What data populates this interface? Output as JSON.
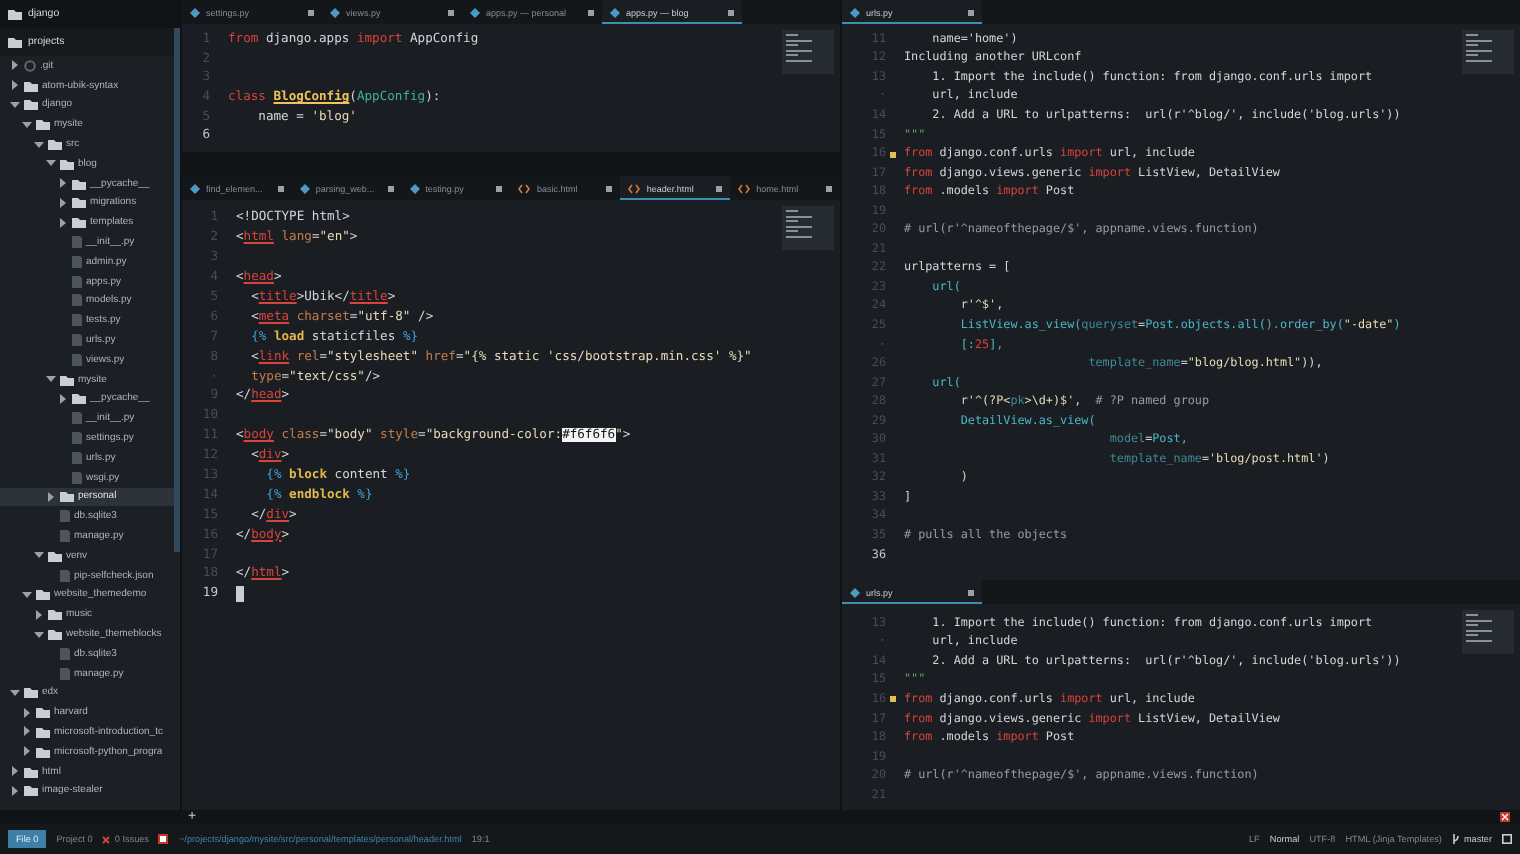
{
  "sidebar": {
    "roots": [
      {
        "name": "django"
      },
      {
        "name": "projects",
        "children": [
          {
            "name": ".git",
            "kind": "repo",
            "expanded": false,
            "selected": false
          },
          {
            "name": "atom-ubik-syntax",
            "kind": "folder",
            "expanded": false,
            "selected": false
          },
          {
            "name": "django",
            "kind": "folder",
            "expanded": true,
            "selected": false,
            "children": [
              {
                "name": "mysite",
                "kind": "folder",
                "expanded": true,
                "selected": false,
                "children": [
                  {
                    "name": "src",
                    "kind": "folder",
                    "expanded": true,
                    "selected": false,
                    "children": [
                      {
                        "name": "blog",
                        "kind": "folder",
                        "expanded": true,
                        "selected": false,
                        "children": [
                          {
                            "name": "__pycache__",
                            "kind": "folder",
                            "expanded": false,
                            "selected": false
                          },
                          {
                            "name": "migrations",
                            "kind": "folder",
                            "expanded": false,
                            "selected": false
                          },
                          {
                            "name": "templates",
                            "kind": "folder",
                            "expanded": false,
                            "selected": false
                          },
                          {
                            "name": "__init__.py",
                            "kind": "file",
                            "selected": false
                          },
                          {
                            "name": "admin.py",
                            "kind": "file",
                            "selected": false
                          },
                          {
                            "name": "apps.py",
                            "kind": "file",
                            "selected": false
                          },
                          {
                            "name": "models.py",
                            "kind": "file",
                            "selected": false
                          },
                          {
                            "name": "tests.py",
                            "kind": "file",
                            "selected": false
                          },
                          {
                            "name": "urls.py",
                            "kind": "file",
                            "selected": false
                          },
                          {
                            "name": "views.py",
                            "kind": "file",
                            "selected": false
                          }
                        ]
                      },
                      {
                        "name": "mysite",
                        "kind": "folder",
                        "expanded": true,
                        "selected": false,
                        "children": [
                          {
                            "name": "__pycache__",
                            "kind": "folder",
                            "expanded": false,
                            "selected": false
                          },
                          {
                            "name": "__init__.py",
                            "kind": "file",
                            "selected": false
                          },
                          {
                            "name": "settings.py",
                            "kind": "file",
                            "selected": false
                          },
                          {
                            "name": "urls.py",
                            "kind": "file",
                            "selected": false
                          },
                          {
                            "name": "wsgi.py",
                            "kind": "file",
                            "selected": false
                          }
                        ]
                      },
                      {
                        "name": "personal",
                        "kind": "folder",
                        "expanded": false,
                        "selected": true
                      },
                      {
                        "name": "db.sqlite3",
                        "kind": "file",
                        "selected": false
                      },
                      {
                        "name": "manage.py",
                        "kind": "file",
                        "selected": false
                      }
                    ]
                  },
                  {
                    "name": "venv",
                    "kind": "folder",
                    "expanded": true,
                    "selected": false,
                    "children": [
                      {
                        "name": "pip-selfcheck.json",
                        "kind": "file",
                        "selected": false
                      }
                    ]
                  }
                ]
              },
              {
                "name": "website_themedemo",
                "kind": "folder",
                "expanded": true,
                "selected": false,
                "children": [
                  {
                    "name": "music",
                    "kind": "folder",
                    "expanded": false,
                    "selected": false
                  },
                  {
                    "name": "website_themeblocks",
                    "kind": "folder",
                    "expanded": true,
                    "selected": false,
                    "children": [
                      {
                        "name": "db.sqlite3",
                        "kind": "file",
                        "selected": false
                      },
                      {
                        "name": "manage.py",
                        "kind": "file",
                        "selected": false
                      }
                    ]
                  }
                ]
              }
            ]
          },
          {
            "name": "edx",
            "kind": "folder",
            "expanded": true,
            "selected": false,
            "children": [
              {
                "name": "harvard",
                "kind": "folder",
                "expanded": false,
                "selected": false
              },
              {
                "name": "microsoft-introduction_tc",
                "kind": "folder",
                "expanded": false,
                "selected": false
              },
              {
                "name": "microsoft-python_progra",
                "kind": "folder",
                "expanded": false,
                "selected": false
              }
            ]
          },
          {
            "name": "html",
            "kind": "folder",
            "expanded": false,
            "selected": false
          },
          {
            "name": "image-stealer",
            "kind": "folder",
            "expanded": false,
            "selected": false
          }
        ]
      }
    ]
  },
  "panes": [
    {
      "focused": false,
      "tabs": [
        {
          "label": "settings.py",
          "kind": "python",
          "selected": false
        },
        {
          "label": "views.py",
          "kind": "python",
          "selected": false
        },
        {
          "label": "apps.py — personal",
          "kind": "python",
          "selected": false
        },
        {
          "label": "apps.py — blog",
          "kind": "python",
          "selected": true
        }
      ],
      "lines": [
        {
          "number": "1",
          "current": false,
          "changed": false,
          "tokens": [
            {
              "text": "from",
              "kind": "kw"
            },
            {
              "text": " django.apps ",
              "kind": "plain"
            },
            {
              "text": "import",
              "kind": "kw"
            },
            {
              "text": " AppConfig",
              "kind": "plain"
            }
          ]
        },
        {
          "number": "2",
          "current": false,
          "changed": false
        },
        {
          "number": "3",
          "current": false,
          "changed": false
        },
        {
          "number": "4",
          "current": false,
          "changed": false,
          "tokens": [
            {
              "text": "class ",
              "kind": "kw"
            },
            {
              "text": "BlogConfig",
              "kind": "cls"
            },
            {
              "text": "(",
              "kind": "plain"
            },
            {
              "text": "AppConfig",
              "kind": "base"
            },
            {
              "text": "):",
              "kind": "plain"
            }
          ]
        },
        {
          "number": "5",
          "current": false,
          "changed": false,
          "tokens": [
            {
              "text": "    name = ",
              "kind": "plain"
            },
            {
              "text": "'blog'",
              "kind": "str"
            }
          ]
        },
        {
          "number": "6",
          "current": true,
          "changed": false
        }
      ]
    },
    {
      "focused": true,
      "tabs": [
        {
          "label": "find_elemen...",
          "kind": "python",
          "selected": false
        },
        {
          "label": "parsing_web...",
          "kind": "python",
          "selected": false
        },
        {
          "label": "testing.py",
          "kind": "python",
          "selected": false
        },
        {
          "label": "basic.html",
          "kind": "html",
          "selected": false
        },
        {
          "label": "header.html",
          "kind": "html",
          "selected": true
        },
        {
          "label": "home.html",
          "kind": "html",
          "selected": false
        }
      ],
      "lines": [
        {
          "number": "1",
          "current": false,
          "changed": false,
          "tokens": [
            {
              "text": "<!DOCTYPE html>",
              "kind": "plain"
            }
          ]
        },
        {
          "number": "2",
          "current": false,
          "changed": false,
          "tokens": [
            {
              "text": "<",
              "kind": "plain"
            },
            {
              "text": "html",
              "kind": "tag"
            },
            {
              "text": " lang",
              "kind": "attr"
            },
            {
              "text": "=",
              "kind": "plain"
            },
            {
              "text": "\"en\"",
              "kind": "str"
            },
            {
              "text": ">",
              "kind": "plain"
            }
          ]
        },
        {
          "number": "3",
          "current": false,
          "changed": false
        },
        {
          "number": "4",
          "current": false,
          "changed": false,
          "tokens": [
            {
              "text": "<",
              "kind": "plain"
            },
            {
              "text": "head",
              "kind": "tag"
            },
            {
              "text": ">",
              "kind": "plain"
            }
          ]
        },
        {
          "number": "5",
          "current": false,
          "changed": false,
          "tokens": [
            {
              "text": "  <",
              "kind": "plain"
            },
            {
              "text": "title",
              "kind": "tag"
            },
            {
              "text": ">Ubik</",
              "kind": "plain"
            },
            {
              "text": "title",
              "kind": "tag"
            },
            {
              "text": ">",
              "kind": "plain"
            }
          ]
        },
        {
          "number": "6",
          "current": false,
          "changed": false,
          "tokens": [
            {
              "text": "  <",
              "kind": "plain"
            },
            {
              "text": "meta",
              "kind": "tag"
            },
            {
              "text": " charset",
              "kind": "attr"
            },
            {
              "text": "=",
              "kind": "plain"
            },
            {
              "text": "\"utf-8\"",
              "kind": "str"
            },
            {
              "text": " />",
              "kind": "plain"
            }
          ]
        },
        {
          "number": "7",
          "current": false,
          "changed": false,
          "tokens": [
            {
              "text": "  {%",
              "kind": "tpl"
            },
            {
              "text": " load",
              "kind": "blk"
            },
            {
              "text": " staticfiles ",
              "kind": "plain"
            },
            {
              "text": "%}",
              "kind": "tpl"
            }
          ]
        },
        {
          "number": "8",
          "current": false,
          "changed": false,
          "tokens": [
            {
              "text": "  <",
              "kind": "plain"
            },
            {
              "text": "link",
              "kind": "tag"
            },
            {
              "text": " rel",
              "kind": "attr"
            },
            {
              "text": "=",
              "kind": "plain"
            },
            {
              "text": "\"stylesheet\"",
              "kind": "str"
            },
            {
              "text": " href",
              "kind": "attr"
            },
            {
              "text": "=",
              "kind": "plain"
            },
            {
              "text": "\"{% static 'css/bootstrap.min.css' %}\"",
              "kind": "str"
            }
          ]
        },
        {
          "number": "·",
          "current": false,
          "changed": false,
          "tokens": [
            {
              "text": "  type",
              "kind": "attr"
            },
            {
              "text": "=",
              "kind": "plain"
            },
            {
              "text": "\"text/css\"",
              "kind": "str"
            },
            {
              "text": "/>",
              "kind": "plain"
            }
          ]
        },
        {
          "number": "9",
          "current": false,
          "changed": false,
          "tokens": [
            {
              "text": "</",
              "kind": "plain"
            },
            {
              "text": "head",
              "kind": "tag"
            },
            {
              "text": ">",
              "kind": "plain"
            }
          ]
        },
        {
          "number": "10",
          "current": false,
          "changed": false
        },
        {
          "number": "11",
          "current": false,
          "changed": false,
          "tokens": [
            {
              "text": "<",
              "kind": "plain"
            },
            {
              "text": "body",
              "kind": "tag"
            },
            {
              "text": " class",
              "kind": "attr"
            },
            {
              "text": "=",
              "kind": "plain"
            },
            {
              "text": "\"body\"",
              "kind": "str"
            },
            {
              "text": " style",
              "kind": "attr"
            },
            {
              "text": "=",
              "kind": "plain"
            },
            {
              "text": "\"background-color:",
              "kind": "str"
            },
            {
              "text": "#f6f6f6",
              "kind": "hl"
            },
            {
              "text": "\"",
              "kind": "str"
            },
            {
              "text": ">",
              "kind": "plain"
            }
          ]
        },
        {
          "number": "12",
          "current": false,
          "changed": false,
          "tokens": [
            {
              "text": "  <",
              "kind": "plain"
            },
            {
              "text": "div",
              "kind": "tag"
            },
            {
              "text": ">",
              "kind": "plain"
            }
          ]
        },
        {
          "number": "13",
          "current": false,
          "changed": false,
          "tokens": [
            {
              "text": "    {%",
              "kind": "tpl"
            },
            {
              "text": " block",
              "kind": "blk"
            },
            {
              "text": " content ",
              "kind": "plain"
            },
            {
              "text": "%}",
              "kind": "tpl"
            }
          ]
        },
        {
          "number": "14",
          "current": false,
          "changed": false,
          "tokens": [
            {
              "text": "    {%",
              "kind": "tpl"
            },
            {
              "text": " endblock",
              "kind": "blk"
            },
            {
              "text": " %}",
              "kind": "tpl"
            }
          ]
        },
        {
          "number": "15",
          "current": false,
          "changed": false,
          "tokens": [
            {
              "text": "  </",
              "kind": "plain"
            },
            {
              "text": "div",
              "kind": "tag"
            },
            {
              "text": ">",
              "kind": "plain"
            }
          ]
        },
        {
          "number": "16",
          "current": false,
          "changed": false,
          "tokens": [
            {
              "text": "</",
              "kind": "plain"
            },
            {
              "text": "body",
              "kind": "tag"
            },
            {
              "text": ">",
              "kind": "plain"
            }
          ]
        },
        {
          "number": "17",
          "current": false,
          "changed": false
        },
        {
          "number": "18",
          "current": false,
          "changed": false,
          "tokens": [
            {
              "text": "</",
              "kind": "plain"
            },
            {
              "text": "html",
              "kind": "tag"
            },
            {
              "text": ">",
              "kind": "plain"
            }
          ]
        },
        {
          "number": "19",
          "current": true,
          "changed": false
        }
      ]
    },
    {
      "focused": false,
      "tabs": [
        {
          "label": "urls.py",
          "kind": "python",
          "selected": true
        }
      ],
      "lines": [
        {
          "number": "11",
          "current": false,
          "changed": false,
          "tokens": [
            {
              "text": "    name='home')",
              "kind": "plain"
            }
          ]
        },
        {
          "number": "12",
          "current": false,
          "changed": false,
          "tokens": [
            {
              "text": "Including another URLconf",
              "kind": "plain"
            }
          ]
        },
        {
          "number": "13",
          "current": false,
          "changed": false,
          "tokens": [
            {
              "text": "    1. Import the include() function: from django.conf.urls import",
              "kind": "plain"
            }
          ]
        },
        {
          "number": "·",
          "current": false,
          "changed": false,
          "tokens": [
            {
              "text": "    url, include",
              "kind": "plain"
            }
          ]
        },
        {
          "number": "14",
          "current": false,
          "changed": false,
          "tokens": [
            {
              "text": "    2. Add a URL to urlpatterns:  url(r'^blog/', include('blog.urls'))",
              "kind": "plain"
            }
          ]
        },
        {
          "number": "15",
          "current": false,
          "changed": false,
          "tokens": [
            {
              "text": "\"\"\"",
              "kind": "doc"
            }
          ]
        },
        {
          "number": "16",
          "current": false,
          "changed": true,
          "tokens": [
            {
              "text": "from",
              "kind": "kw"
            },
            {
              "text": " django.conf.urls ",
              "kind": "plain"
            },
            {
              "text": "import",
              "kind": "kw"
            },
            {
              "text": " url, include",
              "kind": "plain"
            }
          ]
        },
        {
          "number": "17",
          "current": false,
          "changed": false,
          "tokens": [
            {
              "text": "from",
              "kind": "kw"
            },
            {
              "text": " django.views.generic ",
              "kind": "plain"
            },
            {
              "text": "import",
              "kind": "kw"
            },
            {
              "text": " ListView, DetailView",
              "kind": "plain"
            }
          ]
        },
        {
          "number": "18",
          "current": false,
          "changed": false,
          "tokens": [
            {
              "text": "from",
              "kind": "kw"
            },
            {
              "text": " .models ",
              "kind": "plain"
            },
            {
              "text": "import",
              "kind": "kw"
            },
            {
              "text": " Post",
              "kind": "plain"
            }
          ]
        },
        {
          "number": "19",
          "current": false,
          "changed": false
        },
        {
          "number": "20",
          "current": false,
          "changed": false,
          "tokens": [
            {
              "text": "# url(r'^nameofthepage/$', appname.views.function)",
              "kind": "cmt"
            }
          ]
        },
        {
          "number": "21",
          "current": false,
          "changed": false
        },
        {
          "number": "22",
          "current": false,
          "changed": false,
          "tokens": [
            {
              "text": "urlpatterns = [",
              "kind": "plain"
            }
          ]
        },
        {
          "number": "23",
          "current": false,
          "changed": false,
          "tokens": [
            {
              "text": "    url(",
              "kind": "fn"
            }
          ]
        },
        {
          "number": "24",
          "current": false,
          "changed": false,
          "tokens": [
            {
              "text": "        r",
              "kind": "plain"
            },
            {
              "text": "'^$'",
              "kind": "str"
            },
            {
              "text": ",",
              "kind": "plain"
            }
          ]
        },
        {
          "number": "25",
          "current": false,
          "changed": false,
          "tokens": [
            {
              "text": "        ListView.as_view(",
              "kind": "fn"
            },
            {
              "text": "queryset",
              "kind": "param"
            },
            {
              "text": "=",
              "kind": "plain"
            },
            {
              "text": "Post.objects.all().order_by(",
              "kind": "fn"
            },
            {
              "text": "\"-date\"",
              "kind": "str"
            },
            {
              "text": ")",
              "kind": "fn"
            }
          ]
        },
        {
          "number": "·",
          "current": false,
          "changed": false,
          "tokens": [
            {
              "text": "        [:",
              "kind": "fn"
            },
            {
              "text": "25",
              "kind": "num"
            },
            {
              "text": "],",
              "kind": "fn"
            }
          ]
        },
        {
          "number": "26",
          "current": false,
          "changed": false,
          "tokens": [
            {
              "text": "                          template_name",
              "kind": "param"
            },
            {
              "text": "=",
              "kind": "plain"
            },
            {
              "text": "\"blog/blog.html\"",
              "kind": "str"
            },
            {
              "text": ")),",
              "kind": "plain"
            }
          ]
        },
        {
          "number": "27",
          "current": false,
          "changed": false,
          "tokens": [
            {
              "text": "    url(",
              "kind": "fn"
            }
          ]
        },
        {
          "number": "28",
          "current": false,
          "changed": false,
          "tokens": [
            {
              "text": "        r",
              "kind": "plain"
            },
            {
              "text": "'^(?P<",
              "kind": "str"
            },
            {
              "text": "pk",
              "kind": "param"
            },
            {
              "text": ">\\d+)$'",
              "kind": "str"
            },
            {
              "text": ",  ",
              "kind": "plain"
            },
            {
              "text": "# ?P named group",
              "kind": "cmt"
            }
          ]
        },
        {
          "number": "29",
          "current": false,
          "changed": false,
          "tokens": [
            {
              "text": "        DetailView.as_view(",
              "kind": "fn"
            }
          ]
        },
        {
          "number": "30",
          "current": false,
          "changed": false,
          "tokens": [
            {
              "text": "                             model",
              "kind": "param"
            },
            {
              "text": "=",
              "kind": "plain"
            },
            {
              "text": "Post,",
              "kind": "fn"
            }
          ]
        },
        {
          "number": "31",
          "current": false,
          "changed": false,
          "tokens": [
            {
              "text": "                             template_name",
              "kind": "param"
            },
            {
              "text": "=",
              "kind": "plain"
            },
            {
              "text": "'blog/post.html'",
              "kind": "str"
            },
            {
              "text": ")",
              "kind": "plain"
            }
          ]
        },
        {
          "number": "32",
          "current": false,
          "changed": false,
          "tokens": [
            {
              "text": "        )",
              "kind": "plain"
            }
          ]
        },
        {
          "number": "33",
          "current": false,
          "changed": false,
          "tokens": [
            {
              "text": "]",
              "kind": "plain"
            }
          ]
        },
        {
          "number": "34",
          "current": false,
          "changed": false
        },
        {
          "number": "35",
          "current": false,
          "changed": false,
          "tokens": [
            {
              "text": "# pulls all the objects",
              "kind": "cmt"
            }
          ]
        },
        {
          "number": "36",
          "current": true,
          "changed": false
        }
      ]
    },
    {
      "focused": false,
      "tabs": [
        {
          "label": "urls.py",
          "kind": "python",
          "selected": true
        }
      ],
      "lines": [
        {
          "number": "13",
          "current": false,
          "changed": false,
          "tokens": [
            {
              "text": "    1. Import the include() function: from django.conf.urls import",
              "kind": "plain"
            }
          ]
        },
        {
          "number": "·",
          "current": false,
          "changed": false,
          "tokens": [
            {
              "text": "    url, include",
              "kind": "plain"
            }
          ]
        },
        {
          "number": "14",
          "current": false,
          "changed": false,
          "tokens": [
            {
              "text": "    2. Add a URL to urlpatterns:  url(r'^blog/', include('blog.urls'))",
              "kind": "plain"
            }
          ]
        },
        {
          "number": "15",
          "current": false,
          "changed": false,
          "tokens": [
            {
              "text": "\"\"\"",
              "kind": "doc"
            }
          ]
        },
        {
          "number": "16",
          "current": false,
          "changed": true,
          "tokens": [
            {
              "text": "from",
              "kind": "kw"
            },
            {
              "text": " django.conf.urls ",
              "kind": "plain"
            },
            {
              "text": "import",
              "kind": "kw"
            },
            {
              "text": " url, include",
              "kind": "plain"
            }
          ]
        },
        {
          "number": "17",
          "current": false,
          "changed": false,
          "tokens": [
            {
              "text": "from",
              "kind": "kw"
            },
            {
              "text": " django.views.generic ",
              "kind": "plain"
            },
            {
              "text": "import",
              "kind": "kw"
            },
            {
              "text": " ListView, DetailView",
              "kind": "plain"
            }
          ]
        },
        {
          "number": "18",
          "current": false,
          "changed": false,
          "tokens": [
            {
              "text": "from",
              "kind": "kw"
            },
            {
              "text": " .models ",
              "kind": "plain"
            },
            {
              "text": "import",
              "kind": "kw"
            },
            {
              "text": " Post",
              "kind": "plain"
            }
          ]
        },
        {
          "number": "19",
          "current": false,
          "changed": false
        },
        {
          "number": "20",
          "current": false,
          "changed": false,
          "tokens": [
            {
              "text": "# url(r'^nameofthepage/$', appname.views.function)",
              "kind": "cmt"
            }
          ]
        },
        {
          "number": "21",
          "current": false,
          "changed": false
        }
      ]
    }
  ],
  "dock": {
    "add_button": "+"
  },
  "status_bar": {
    "file_button": "File 0",
    "project": "Project 0",
    "issues": "0 Issues",
    "path": "~/projects/django/mysite/src/personal/templates/personal/header.html",
    "cursor": "19:1",
    "line_ending": "LF",
    "mode": "Normal",
    "encoding": "UTF-8",
    "grammar": "HTML (Jinja Templates)",
    "branch": "master"
  }
}
